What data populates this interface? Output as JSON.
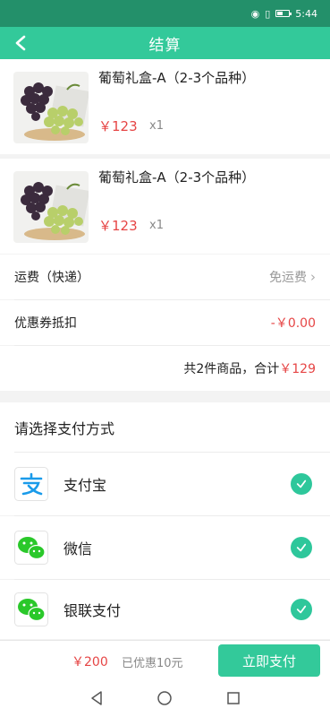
{
  "status_bar": {
    "time": "5:44"
  },
  "nav": {
    "title": "结算"
  },
  "products": [
    {
      "name": "葡萄礼盒-A（2-3个品种）",
      "price": "￥123",
      "qty": "x1"
    },
    {
      "name": "葡萄礼盒-A（2-3个品种）",
      "price": "￥123",
      "qty": "x1"
    }
  ],
  "shipping": {
    "label": "运费（快递）",
    "value": "免运费"
  },
  "coupon": {
    "label": "优惠券抵扣",
    "value": "-￥0.00"
  },
  "summary": {
    "text": "共2件商品，合计",
    "amount": "￥129"
  },
  "payment": {
    "header": "请选择支付方式",
    "methods": [
      {
        "label": "支付宝",
        "icon": "alipay-icon",
        "selected": true
      },
      {
        "label": "微信",
        "icon": "wechat-icon",
        "selected": true
      },
      {
        "label": "银联支付",
        "icon": "unionpay-icon",
        "selected": true
      }
    ]
  },
  "bottom": {
    "total": "￥200",
    "discount": "已优惠10元",
    "pay_button": "立即支付"
  },
  "colors": {
    "primary": "#33c99a",
    "status_bar": "#23906a",
    "price_red": "#e64545",
    "check": "#2ec79b"
  }
}
